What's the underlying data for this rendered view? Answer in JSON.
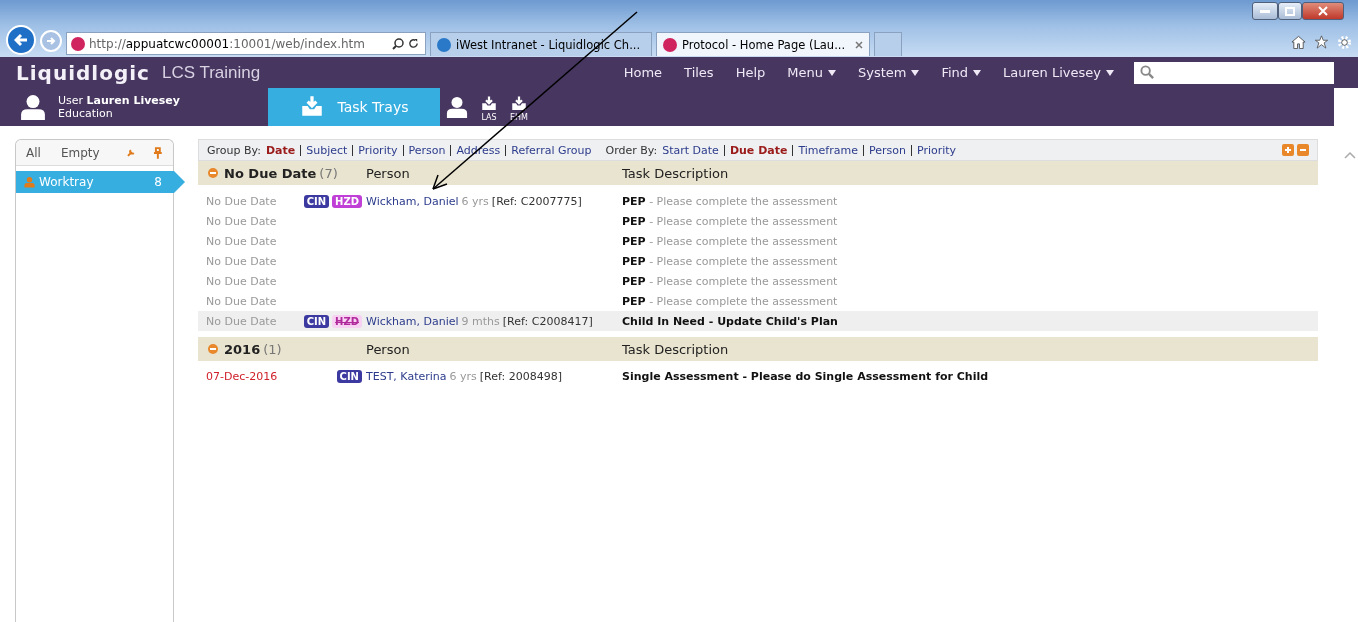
{
  "browser": {
    "address": {
      "scheme": "http://",
      "host": "appuatcwc00001",
      "path": ":10001/web/index.htm"
    },
    "tabs": [
      {
        "title": "iWest Intranet - Liquidlogic Ch...",
        "kind": "intranet",
        "selected": false
      },
      {
        "title": "Protocol - Home Page (Lau...",
        "kind": "protocol",
        "selected": true
      }
    ]
  },
  "app": {
    "brand": "Liquidlogic",
    "product": "LCS Training",
    "nav": [
      {
        "label": "Home",
        "dropdown": false
      },
      {
        "label": "Tiles",
        "dropdown": false
      },
      {
        "label": "Help",
        "dropdown": false
      },
      {
        "label": "Menu",
        "dropdown": true
      },
      {
        "label": "System",
        "dropdown": true
      },
      {
        "label": "Find",
        "dropdown": true
      },
      {
        "label": "Lauren Livesey",
        "dropdown": true
      }
    ],
    "user": {
      "prefix": "User",
      "name": "Lauren Livesey",
      "role": "Education"
    },
    "modules": [
      {
        "kind": "tray",
        "label": "Task Trays",
        "selected": true
      },
      {
        "kind": "person",
        "selected": false
      },
      {
        "kind": "tray-small",
        "label": "LAS",
        "selected": false
      },
      {
        "kind": "tray-small",
        "label": "EHM",
        "selected": false
      }
    ]
  },
  "sidebar": {
    "filters": [
      "All",
      "Empty"
    ],
    "items": [
      {
        "label": "Worktray",
        "count": "8",
        "selected": true
      }
    ]
  },
  "toolbar": {
    "group_by": {
      "label": "Group By:",
      "options": [
        {
          "label": "Date",
          "selected": true
        },
        {
          "label": "Subject",
          "selected": false
        },
        {
          "label": "Priority",
          "selected": false
        },
        {
          "label": "Person",
          "selected": false
        },
        {
          "label": "Address",
          "selected": false
        },
        {
          "label": "Referral Group",
          "selected": false
        }
      ]
    },
    "order_by": {
      "label": "Order By:",
      "options": [
        {
          "label": "Start Date",
          "selected": false
        },
        {
          "label": "Due Date",
          "selected": true
        },
        {
          "label": "Timeframe",
          "selected": false
        },
        {
          "label": "Person",
          "selected": false
        },
        {
          "label": "Priority",
          "selected": false
        }
      ]
    }
  },
  "groups": [
    {
      "title": "No Due Date",
      "count": "(7)",
      "expanded": true,
      "columns": [
        "Person",
        "Task Description"
      ],
      "rows": [
        {
          "due": "No Due Date",
          "overdue": false,
          "highlighted": false,
          "badges": [
            {
              "label": "CIN",
              "kind": "cin",
              "disabled": false
            },
            {
              "label": "HZD",
              "kind": "hzd",
              "disabled": false
            }
          ],
          "person": {
            "name": "Wickham, Daniel",
            "age": "6 yrs",
            "ref": "[Ref: C2007775]"
          },
          "task": {
            "title": "PEP",
            "detail": "- Please complete the assessment"
          }
        },
        {
          "due": "No Due Date",
          "overdue": false,
          "highlighted": false,
          "badges": [],
          "task": {
            "title": "PEP",
            "detail": "- Please complete the assessment"
          }
        },
        {
          "due": "No Due Date",
          "overdue": false,
          "highlighted": false,
          "badges": [],
          "task": {
            "title": "PEP",
            "detail": "- Please complete the assessment"
          }
        },
        {
          "due": "No Due Date",
          "overdue": false,
          "highlighted": false,
          "badges": [],
          "task": {
            "title": "PEP",
            "detail": "- Please complete the assessment"
          }
        },
        {
          "due": "No Due Date",
          "overdue": false,
          "highlighted": false,
          "badges": [],
          "task": {
            "title": "PEP",
            "detail": "- Please complete the assessment"
          }
        },
        {
          "due": "No Due Date",
          "overdue": false,
          "highlighted": false,
          "badges": [],
          "task": {
            "title": "PEP",
            "detail": "- Please complete the assessment"
          }
        },
        {
          "due": "No Due Date",
          "overdue": false,
          "highlighted": true,
          "badges": [
            {
              "label": "CIN",
              "kind": "cin",
              "disabled": false
            },
            {
              "label": "HZD",
              "kind": "hzd",
              "disabled": true
            }
          ],
          "person": {
            "name": "Wickham, Daniel",
            "age": "9 mths",
            "ref": "[Ref: C2008417]"
          },
          "task": {
            "title": "Child In Need - Update Child's Plan"
          }
        }
      ]
    },
    {
      "title": "2016",
      "count": "(1)",
      "expanded": true,
      "columns": [
        "Person",
        "Task Description"
      ],
      "rows": [
        {
          "due": "07-Dec-2016",
          "overdue": true,
          "highlighted": false,
          "badges": [
            {
              "label": "CIN",
              "kind": "cin",
              "disabled": false
            }
          ],
          "person": {
            "name": "TEST, Katerina",
            "age": "6 yrs",
            "ref": "[Ref: 2008498]"
          },
          "task": {
            "title": "Single Assessment - Please do Single Assessment for Child"
          }
        }
      ]
    }
  ]
}
